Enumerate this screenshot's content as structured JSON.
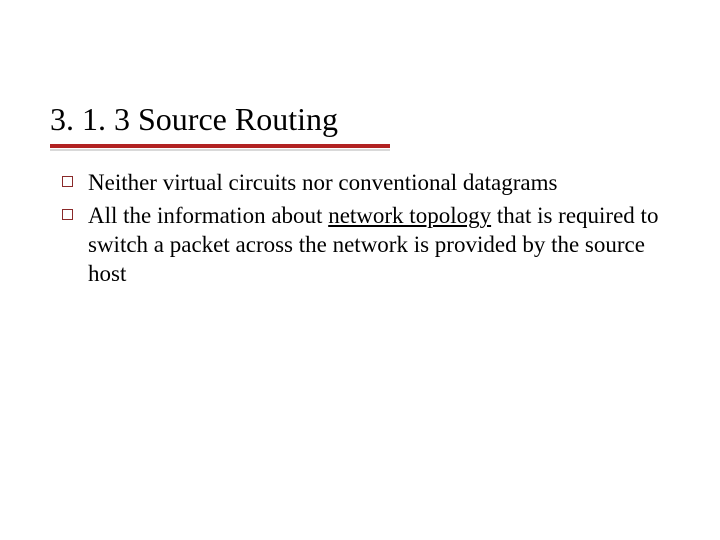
{
  "title": "3. 1. 3 Source Routing",
  "bullets": [
    {
      "pre": "Neither virtual circuits nor conventional datagrams",
      "underlined": "",
      "post": ""
    },
    {
      "pre": "All the information about ",
      "underlined": "network topology",
      "post": " that is required to switch a packet across the network is provided by the source host"
    }
  ]
}
